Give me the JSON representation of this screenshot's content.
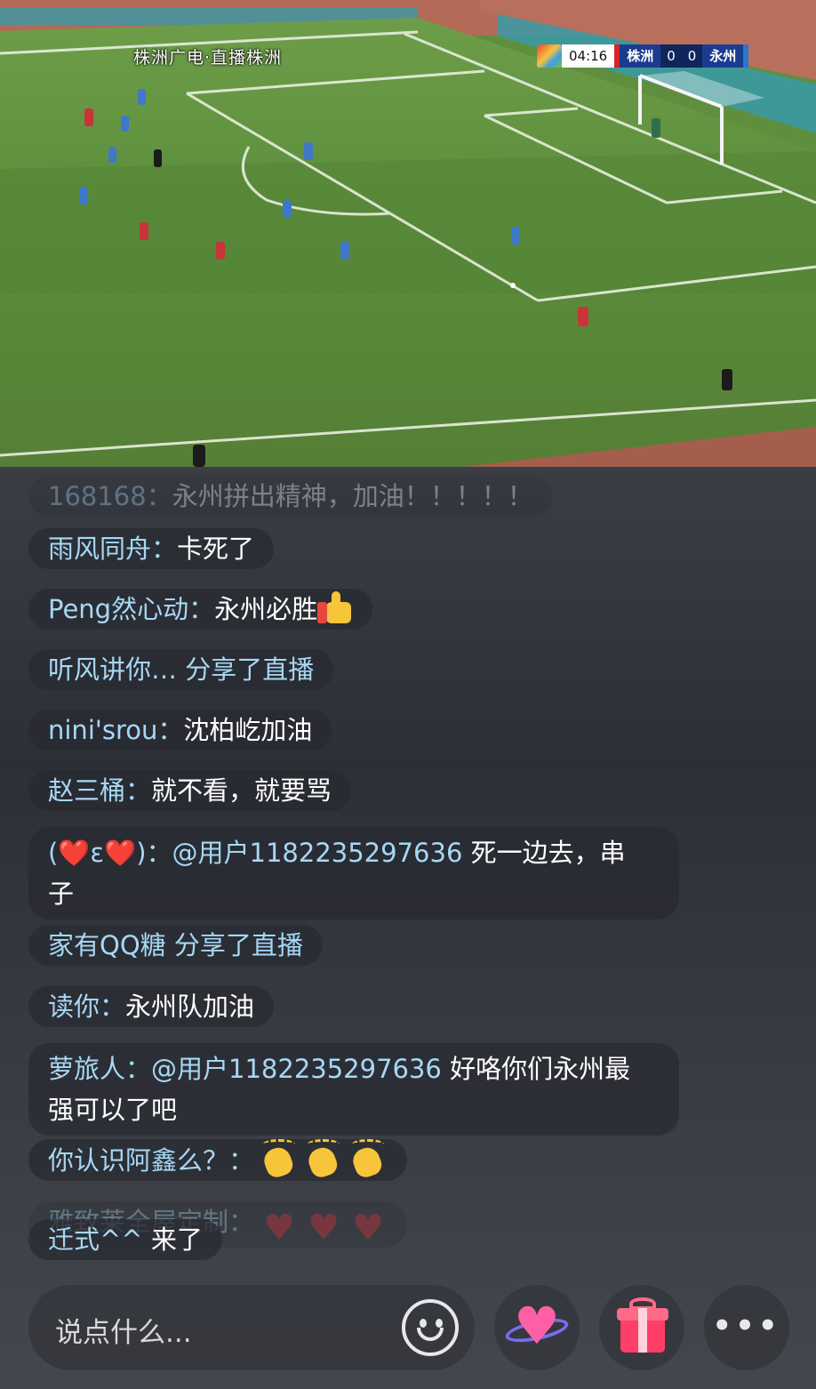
{
  "video": {
    "broadcaster": "株洲广电·直播株洲",
    "scoreboard": {
      "clock": "04:16",
      "home_team": "株洲",
      "home_score": "0",
      "away_score": "0",
      "away_team": "永州"
    },
    "colors": {
      "pitch": "#5f8f3e",
      "home_kit": "#c8343a",
      "away_kit": "#3f78c8"
    }
  },
  "chat": {
    "messages": [
      {
        "user": "168168：",
        "text": "永州拼出精神，加油！！！！！",
        "faded": true
      },
      {
        "user": "雨风同舟：",
        "text": "卡死了"
      },
      {
        "user": "Peng然心动：",
        "text": "永州必胜",
        "emoji": "thumbs-up-icon"
      },
      {
        "user": "听风讲你… 分享了直播",
        "text": ""
      },
      {
        "user": "nini'srou：",
        "text": "沈柏屹加油"
      },
      {
        "user": "赵三桶：",
        "text": "就不看，就要骂"
      },
      {
        "user": "(❤️ε❤️)：",
        "mention": "@用户1182235297636",
        "text": " 死一边去，串",
        "text2": "子"
      },
      {
        "user": "家有QQ糖 分享了直播",
        "text": ""
      },
      {
        "user": "读你：",
        "text": "永州队加油"
      },
      {
        "user": "萝旅人：",
        "mention": "@用户1182235297636",
        "text": " 好咯你们永州最",
        "text2": "强可以了吧"
      },
      {
        "user": "你认识阿鑫么？：",
        "text": "",
        "emoji": "clapping-hands-icon"
      },
      {
        "user": "雅致莱全屋定制：",
        "text": "",
        "emoji": "heart-icon",
        "faded": true
      },
      {
        "user": "迁式^^",
        "text": " 来了"
      }
    ]
  },
  "bottom_bar": {
    "placeholder": "说点什么...",
    "icons": [
      "smile-icon",
      "like-heart-icon",
      "gift-icon",
      "more-icon"
    ],
    "more_label": "•••"
  }
}
